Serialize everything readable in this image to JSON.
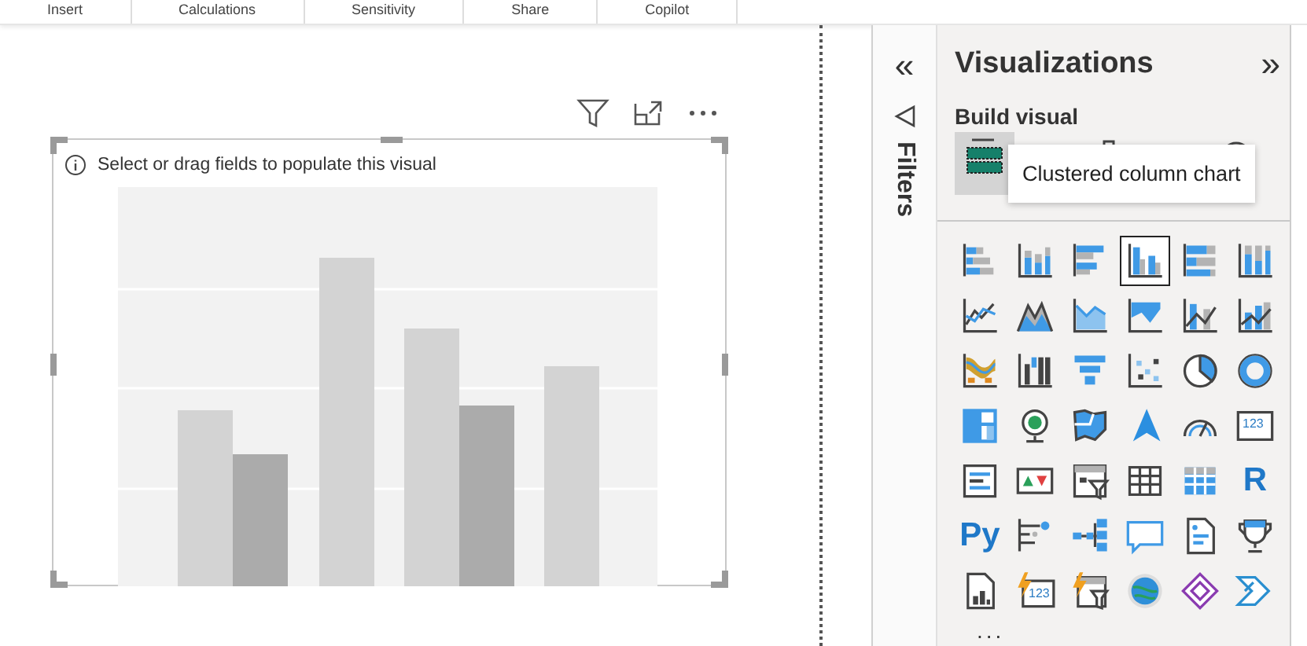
{
  "ribbon": {
    "groups": [
      "Insert",
      "Calculations",
      "Sensitivity",
      "Share",
      "Copilot"
    ]
  },
  "visual": {
    "message": "Select or drag fields to populate this visual"
  },
  "filters_pane": {
    "collapse": "«",
    "title": "Filters"
  },
  "visualizations_pane": {
    "title": "Visualizations",
    "expand": "»",
    "subtitle": "Build visual",
    "build_modes": [
      {
        "kind": "fields",
        "selected": true
      },
      {
        "kind": "format",
        "selected": false
      },
      {
        "kind": "analytics",
        "selected": false
      }
    ],
    "tooltip": "Clustered column chart",
    "visual_types": [
      {
        "kind": "stacked-bar",
        "selected": false
      },
      {
        "kind": "stacked-column",
        "selected": false
      },
      {
        "kind": "clustered-bar",
        "selected": false
      },
      {
        "kind": "clustered-column",
        "selected": true
      },
      {
        "kind": "full-bar",
        "selected": false
      },
      {
        "kind": "full-column",
        "selected": false
      },
      {
        "kind": "line",
        "selected": false
      },
      {
        "kind": "area",
        "selected": false
      },
      {
        "kind": "stacked-area",
        "selected": false
      },
      {
        "kind": "full-area",
        "selected": false
      },
      {
        "kind": "line-column",
        "selected": false
      },
      {
        "kind": "line-stacked-column",
        "selected": false
      },
      {
        "kind": "ribbon",
        "selected": false
      },
      {
        "kind": "waterfall",
        "selected": false
      },
      {
        "kind": "funnel",
        "selected": false
      },
      {
        "kind": "scatter",
        "selected": false
      },
      {
        "kind": "pie",
        "selected": false
      },
      {
        "kind": "donut",
        "selected": false
      },
      {
        "kind": "treemap",
        "selected": false
      },
      {
        "kind": "globe-map",
        "selected": false
      },
      {
        "kind": "filled-map",
        "selected": false
      },
      {
        "kind": "arrow-map",
        "selected": false
      },
      {
        "kind": "gauge",
        "selected": false
      },
      {
        "kind": "card",
        "selected": false,
        "label": "123"
      },
      {
        "kind": "multirow-card",
        "selected": false
      },
      {
        "kind": "kpi",
        "selected": false
      },
      {
        "kind": "slicer",
        "selected": false
      },
      {
        "kind": "table",
        "selected": false
      },
      {
        "kind": "matrix",
        "selected": false
      },
      {
        "kind": "letter",
        "selected": false,
        "label": "R"
      },
      {
        "kind": "letter",
        "selected": false,
        "label": "Py"
      },
      {
        "kind": "influencers",
        "selected": false
      },
      {
        "kind": "decomposition",
        "selected": false
      },
      {
        "kind": "speech",
        "selected": false
      },
      {
        "kind": "document",
        "selected": false
      },
      {
        "kind": "trophy",
        "selected": false
      },
      {
        "kind": "report",
        "selected": false
      },
      {
        "kind": "card-new",
        "selected": false,
        "label": "123"
      },
      {
        "kind": "slicer-new",
        "selected": false
      },
      {
        "kind": "globe",
        "selected": false
      },
      {
        "kind": "diamond",
        "selected": false
      },
      {
        "kind": "chevron",
        "selected": false
      }
    ],
    "more": "..."
  }
}
